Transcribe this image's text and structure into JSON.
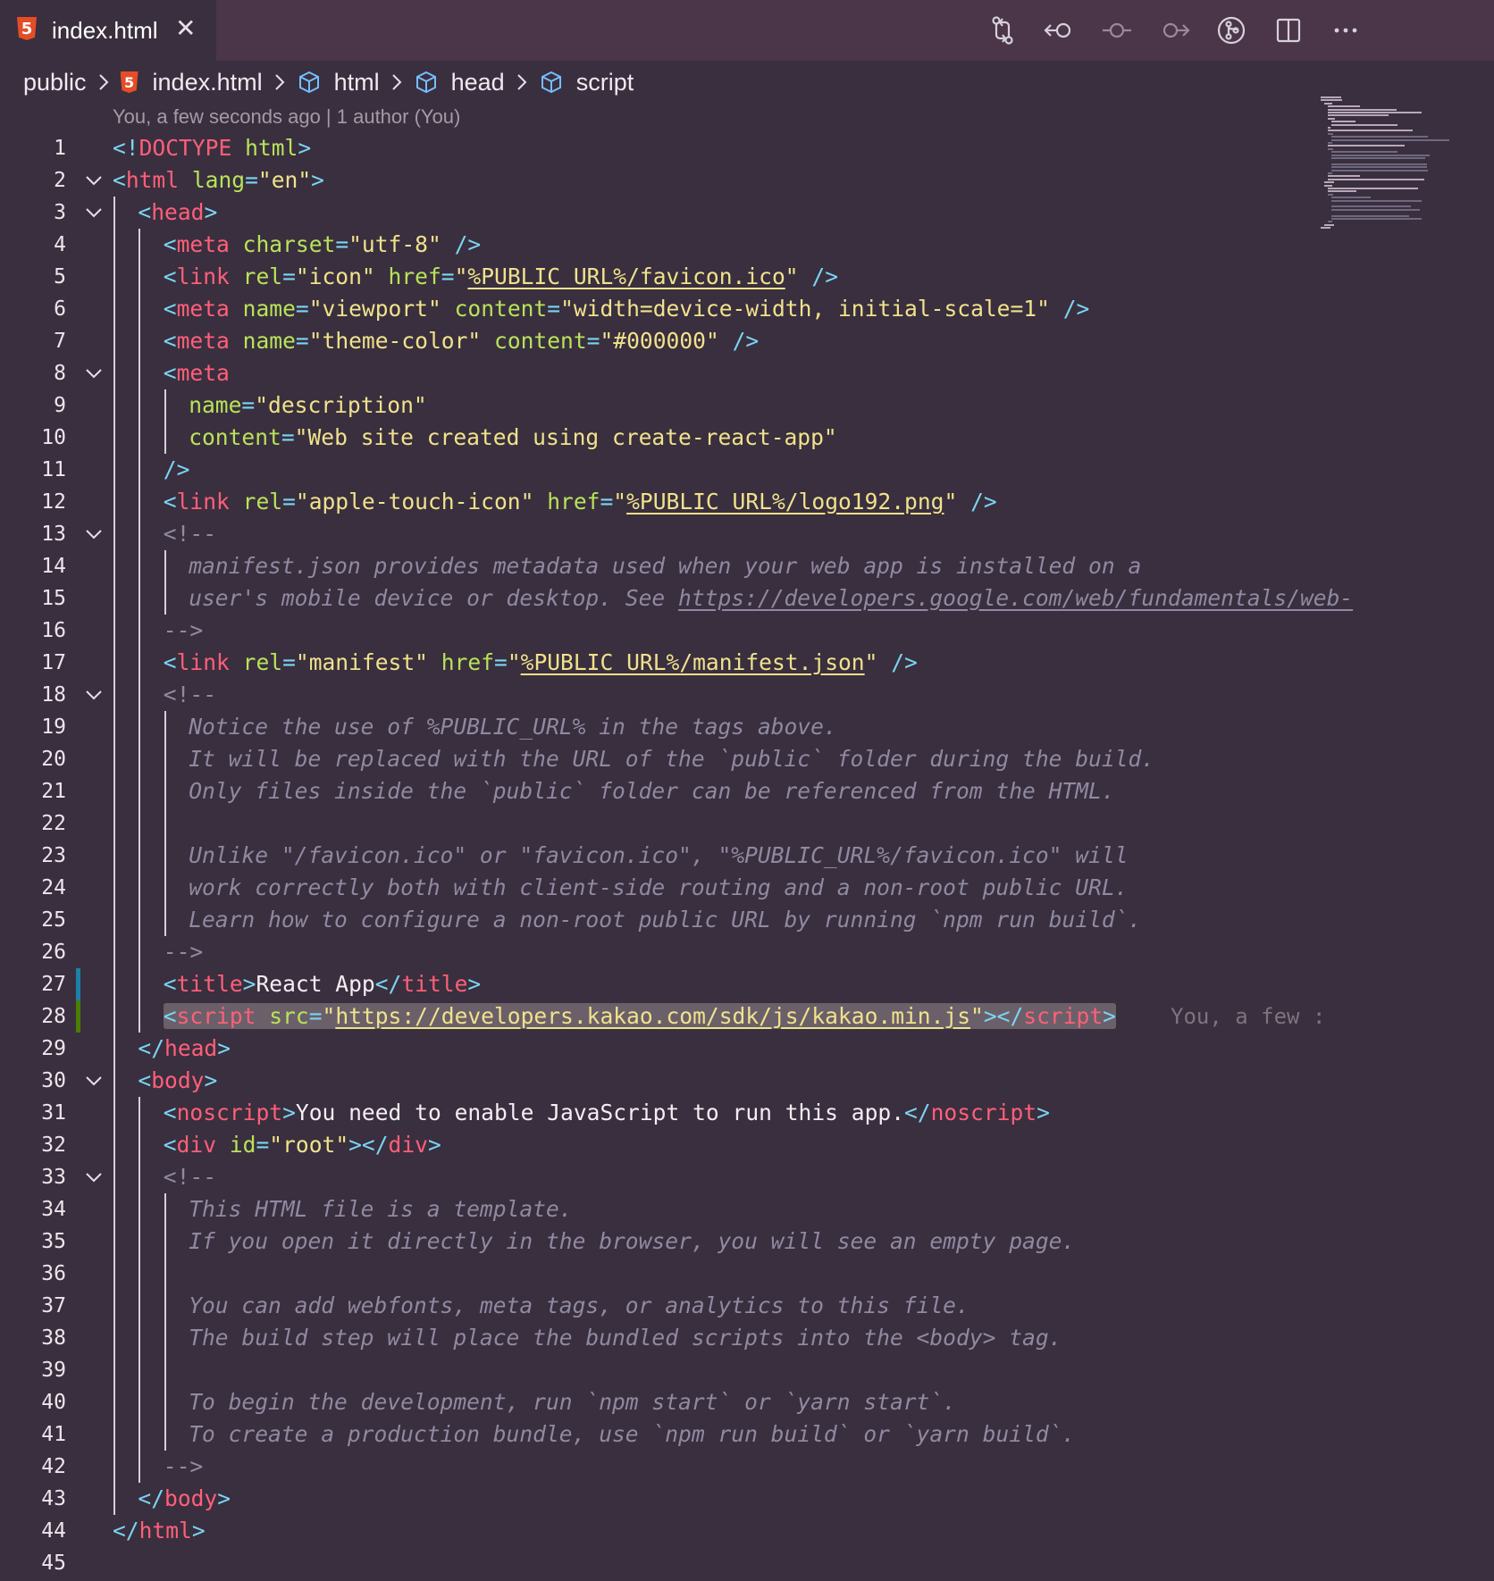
{
  "tab": {
    "title": "index.html",
    "icon": "html5-icon",
    "close_glyph": "✕"
  },
  "toolbar": [
    "source-control-compare-icon",
    "go-back-icon",
    "commit-icon",
    "go-forward-icon",
    "git-graph-icon",
    "split-editor-icon",
    "more-actions-icon"
  ],
  "breadcrumbs": [
    "public",
    "index.html",
    "html",
    "head",
    "script"
  ],
  "codelens": "You, a few seconds ago | 1 author (You)",
  "blame": "You, a few :",
  "colors": {
    "tag": "#ff5f7a",
    "punct": "#7ad5f4",
    "attr": "#b8e35a",
    "string": "#f0e28c",
    "comment": "#8f8aa2",
    "background": "#3a2f3e"
  },
  "lines": [
    {
      "n": "1",
      "fold": false,
      "indent": 0,
      "tokens": [
        [
          "p",
          "<!"
        ],
        [
          "n",
          "DOCTYPE"
        ],
        [
          "x",
          " "
        ],
        [
          "a",
          "html"
        ],
        [
          "p",
          ">"
        ]
      ]
    },
    {
      "n": "2",
      "fold": true,
      "indent": 0,
      "tokens": [
        [
          "p",
          "<"
        ],
        [
          "n",
          "html"
        ],
        [
          "x",
          " "
        ],
        [
          "a",
          "lang"
        ],
        [
          "p",
          "="
        ],
        [
          "s",
          "\"en\""
        ],
        [
          "p",
          ">"
        ]
      ]
    },
    {
      "n": "3",
      "fold": true,
      "indent": 1,
      "tokens": [
        [
          "p",
          "<"
        ],
        [
          "n",
          "head"
        ],
        [
          "p",
          ">"
        ]
      ]
    },
    {
      "n": "4",
      "fold": false,
      "indent": 2,
      "tokens": [
        [
          "p",
          "<"
        ],
        [
          "n",
          "meta"
        ],
        [
          "x",
          " "
        ],
        [
          "a",
          "charset"
        ],
        [
          "p",
          "="
        ],
        [
          "s",
          "\"utf-8\""
        ],
        [
          "x",
          " "
        ],
        [
          "p",
          "/>"
        ]
      ]
    },
    {
      "n": "5",
      "fold": false,
      "indent": 2,
      "tokens": [
        [
          "p",
          "<"
        ],
        [
          "n",
          "link"
        ],
        [
          "x",
          " "
        ],
        [
          "a",
          "rel"
        ],
        [
          "p",
          "="
        ],
        [
          "s",
          "\"icon\""
        ],
        [
          "x",
          " "
        ],
        [
          "a",
          "href"
        ],
        [
          "p",
          "="
        ],
        [
          "s",
          "\""
        ],
        [
          "su",
          "%PUBLIC_URL%/favicon.ico"
        ],
        [
          "s",
          "\""
        ],
        [
          "x",
          " "
        ],
        [
          "p",
          "/>"
        ]
      ]
    },
    {
      "n": "6",
      "fold": false,
      "indent": 2,
      "tokens": [
        [
          "p",
          "<"
        ],
        [
          "n",
          "meta"
        ],
        [
          "x",
          " "
        ],
        [
          "a",
          "name"
        ],
        [
          "p",
          "="
        ],
        [
          "s",
          "\"viewport\""
        ],
        [
          "x",
          " "
        ],
        [
          "a",
          "content"
        ],
        [
          "p",
          "="
        ],
        [
          "s",
          "\"width=device-width, initial-scale=1\""
        ],
        [
          "x",
          " "
        ],
        [
          "p",
          "/>"
        ]
      ]
    },
    {
      "n": "7",
      "fold": false,
      "indent": 2,
      "tokens": [
        [
          "p",
          "<"
        ],
        [
          "n",
          "meta"
        ],
        [
          "x",
          " "
        ],
        [
          "a",
          "name"
        ],
        [
          "p",
          "="
        ],
        [
          "s",
          "\"theme-color\""
        ],
        [
          "x",
          " "
        ],
        [
          "a",
          "content"
        ],
        [
          "p",
          "="
        ],
        [
          "s",
          "\"#000000\""
        ],
        [
          "x",
          " "
        ],
        [
          "p",
          "/>"
        ]
      ]
    },
    {
      "n": "8",
      "fold": true,
      "indent": 2,
      "tokens": [
        [
          "p",
          "<"
        ],
        [
          "n",
          "meta"
        ]
      ]
    },
    {
      "n": "9",
      "fold": false,
      "indent": 3,
      "tokens": [
        [
          "a",
          "name"
        ],
        [
          "p",
          "="
        ],
        [
          "s",
          "\"description\""
        ]
      ]
    },
    {
      "n": "10",
      "fold": false,
      "indent": 3,
      "tokens": [
        [
          "a",
          "content"
        ],
        [
          "p",
          "="
        ],
        [
          "s",
          "\"Web site created using create-react-app\""
        ]
      ]
    },
    {
      "n": "11",
      "fold": false,
      "indent": 2,
      "tokens": [
        [
          "p",
          "/>"
        ]
      ]
    },
    {
      "n": "12",
      "fold": false,
      "indent": 2,
      "tokens": [
        [
          "p",
          "<"
        ],
        [
          "n",
          "link"
        ],
        [
          "x",
          " "
        ],
        [
          "a",
          "rel"
        ],
        [
          "p",
          "="
        ],
        [
          "s",
          "\"apple-touch-icon\""
        ],
        [
          "x",
          " "
        ],
        [
          "a",
          "href"
        ],
        [
          "p",
          "="
        ],
        [
          "s",
          "\""
        ],
        [
          "su",
          "%PUBLIC_URL%/logo192.png"
        ],
        [
          "s",
          "\""
        ],
        [
          "x",
          " "
        ],
        [
          "p",
          "/>"
        ]
      ]
    },
    {
      "n": "13",
      "fold": true,
      "indent": 2,
      "tokens": [
        [
          "cm",
          "<!--"
        ]
      ]
    },
    {
      "n": "14",
      "fold": false,
      "indent": 3,
      "tokens": [
        [
          "c",
          "manifest.json provides metadata used when your web app is installed on a"
        ]
      ]
    },
    {
      "n": "15",
      "fold": false,
      "indent": 3,
      "tokens": [
        [
          "c",
          "user's mobile device or desktop. See "
        ],
        [
          "cu",
          "https://developers.google.com/web/fundamentals/web-"
        ]
      ]
    },
    {
      "n": "16",
      "fold": false,
      "indent": 2,
      "tokens": [
        [
          "cm",
          "-->"
        ]
      ]
    },
    {
      "n": "17",
      "fold": false,
      "indent": 2,
      "tokens": [
        [
          "p",
          "<"
        ],
        [
          "n",
          "link"
        ],
        [
          "x",
          " "
        ],
        [
          "a",
          "rel"
        ],
        [
          "p",
          "="
        ],
        [
          "s",
          "\"manifest\""
        ],
        [
          "x",
          " "
        ],
        [
          "a",
          "href"
        ],
        [
          "p",
          "="
        ],
        [
          "s",
          "\""
        ],
        [
          "su",
          "%PUBLIC_URL%/manifest.json"
        ],
        [
          "s",
          "\""
        ],
        [
          "x",
          " "
        ],
        [
          "p",
          "/>"
        ]
      ]
    },
    {
      "n": "18",
      "fold": true,
      "indent": 2,
      "tokens": [
        [
          "cm",
          "<!--"
        ]
      ]
    },
    {
      "n": "19",
      "fold": false,
      "indent": 3,
      "tokens": [
        [
          "c",
          "Notice the use of %PUBLIC_URL% in the tags above."
        ]
      ]
    },
    {
      "n": "20",
      "fold": false,
      "indent": 3,
      "tokens": [
        [
          "c",
          "It will be replaced with the URL of the `public` folder during the build."
        ]
      ]
    },
    {
      "n": "21",
      "fold": false,
      "indent": 3,
      "tokens": [
        [
          "c",
          "Only files inside the `public` folder can be referenced from the HTML."
        ]
      ]
    },
    {
      "n": "22",
      "fold": false,
      "indent": 3,
      "tokens": []
    },
    {
      "n": "23",
      "fold": false,
      "indent": 3,
      "tokens": [
        [
          "c",
          "Unlike \"/favicon.ico\" or \"favicon.ico\", \"%PUBLIC_URL%/favicon.ico\" will"
        ]
      ]
    },
    {
      "n": "24",
      "fold": false,
      "indent": 3,
      "tokens": [
        [
          "c",
          "work correctly both with client-side routing and a non-root public URL."
        ]
      ]
    },
    {
      "n": "25",
      "fold": false,
      "indent": 3,
      "tokens": [
        [
          "c",
          "Learn how to configure a non-root public URL by running `npm run build`."
        ]
      ]
    },
    {
      "n": "26",
      "fold": false,
      "indent": 2,
      "tokens": [
        [
          "cm",
          "-->"
        ]
      ]
    },
    {
      "n": "27",
      "fold": false,
      "indent": 2,
      "tokens": [
        [
          "p",
          "<"
        ],
        [
          "n",
          "title"
        ],
        [
          "p",
          ">"
        ],
        [
          "x",
          "React App"
        ],
        [
          "p",
          "</"
        ],
        [
          "n",
          "title"
        ],
        [
          "p",
          ">"
        ]
      ]
    },
    {
      "n": "28",
      "fold": false,
      "indent": 2,
      "highlight": true,
      "tokens": [
        [
          "p",
          "<"
        ],
        [
          "n",
          "script"
        ],
        [
          "x",
          " "
        ],
        [
          "a",
          "src"
        ],
        [
          "p",
          "="
        ],
        [
          "s",
          "\""
        ],
        [
          "su",
          "https://developers.kakao.com/sdk/js/kakao.min.js"
        ],
        [
          "s",
          "\""
        ],
        [
          "p",
          "></"
        ],
        [
          "n",
          "script"
        ],
        [
          "p",
          ">"
        ]
      ]
    },
    {
      "n": "29",
      "fold": false,
      "indent": 1,
      "tokens": [
        [
          "p",
          "</"
        ],
        [
          "n",
          "head"
        ],
        [
          "p",
          ">"
        ]
      ]
    },
    {
      "n": "30",
      "fold": true,
      "indent": 1,
      "tokens": [
        [
          "p",
          "<"
        ],
        [
          "n",
          "body"
        ],
        [
          "p",
          ">"
        ]
      ]
    },
    {
      "n": "31",
      "fold": false,
      "indent": 2,
      "tokens": [
        [
          "p",
          "<"
        ],
        [
          "n",
          "noscript"
        ],
        [
          "p",
          ">"
        ],
        [
          "x",
          "You need to enable JavaScript to run this app."
        ],
        [
          "p",
          "</"
        ],
        [
          "n",
          "noscript"
        ],
        [
          "p",
          ">"
        ]
      ]
    },
    {
      "n": "32",
      "fold": false,
      "indent": 2,
      "tokens": [
        [
          "p",
          "<"
        ],
        [
          "n",
          "div"
        ],
        [
          "x",
          " "
        ],
        [
          "a",
          "id"
        ],
        [
          "p",
          "="
        ],
        [
          "s",
          "\"root\""
        ],
        [
          "p",
          "></"
        ],
        [
          "n",
          "div"
        ],
        [
          "p",
          ">"
        ]
      ]
    },
    {
      "n": "33",
      "fold": true,
      "indent": 2,
      "tokens": [
        [
          "cm",
          "<!--"
        ]
      ]
    },
    {
      "n": "34",
      "fold": false,
      "indent": 3,
      "tokens": [
        [
          "c",
          "This HTML file is a template."
        ]
      ]
    },
    {
      "n": "35",
      "fold": false,
      "indent": 3,
      "tokens": [
        [
          "c",
          "If you open it directly in the browser, you will see an empty page."
        ]
      ]
    },
    {
      "n": "36",
      "fold": false,
      "indent": 3,
      "tokens": []
    },
    {
      "n": "37",
      "fold": false,
      "indent": 3,
      "tokens": [
        [
          "c",
          "You can add webfonts, meta tags, or analytics to this file."
        ]
      ]
    },
    {
      "n": "38",
      "fold": false,
      "indent": 3,
      "tokens": [
        [
          "c",
          "The build step will place the bundled scripts into the <body> tag."
        ]
      ]
    },
    {
      "n": "39",
      "fold": false,
      "indent": 3,
      "tokens": []
    },
    {
      "n": "40",
      "fold": false,
      "indent": 3,
      "tokens": [
        [
          "c",
          "To begin the development, run `npm start` or `yarn start`."
        ]
      ]
    },
    {
      "n": "41",
      "fold": false,
      "indent": 3,
      "tokens": [
        [
          "c",
          "To create a production bundle, use `npm run build` or `yarn build`."
        ]
      ]
    },
    {
      "n": "42",
      "fold": false,
      "indent": 2,
      "tokens": [
        [
          "cm",
          "-->"
        ]
      ]
    },
    {
      "n": "43",
      "fold": false,
      "indent": 1,
      "tokens": [
        [
          "p",
          "</"
        ],
        [
          "n",
          "body"
        ],
        [
          "p",
          ">"
        ]
      ]
    },
    {
      "n": "44",
      "fold": false,
      "indent": 0,
      "tokens": [
        [
          "p",
          "</"
        ],
        [
          "n",
          "html"
        ],
        [
          "p",
          ">"
        ]
      ]
    },
    {
      "n": "45",
      "fold": false,
      "indent": 0,
      "tokens": []
    }
  ]
}
